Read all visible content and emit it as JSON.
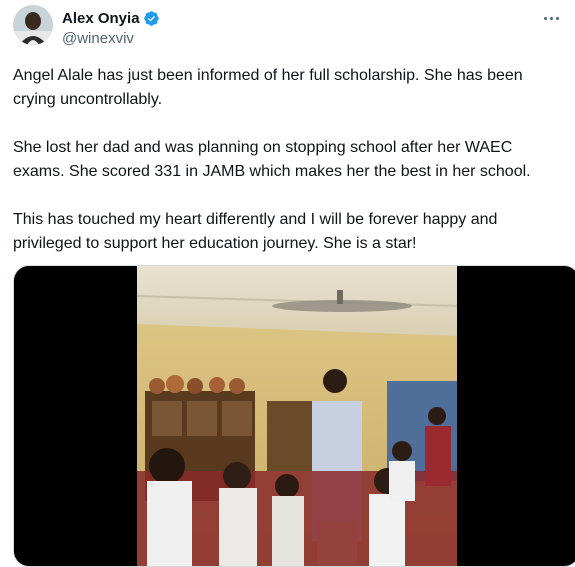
{
  "author": {
    "display_name": "Alex Onyia",
    "handle": "@winexviv",
    "verified": true
  },
  "tweet": {
    "paragraphs": [
      "Angel Alale has just been informed of her full scholarship. She has been crying uncontrollably.",
      "She lost her dad and was planning on stopping school after her WAEC exams. She scored 331 in JAMB which makes her the best in her school.",
      "This has touched my heart differently and I will be forever happy and privileged to support her education journey. She is a star!"
    ]
  },
  "icons": {
    "verified": "verified-badge-icon",
    "more": "more-options-icon"
  },
  "colors": {
    "verified_blue": "#1d9bf0",
    "text_primary": "#0f1419",
    "text_secondary": "#536471"
  }
}
